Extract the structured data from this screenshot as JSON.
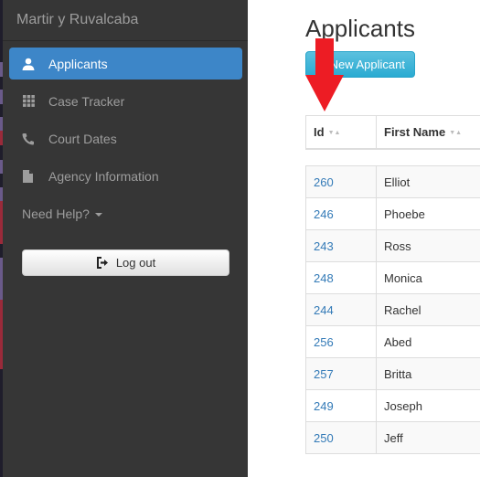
{
  "sidebar": {
    "brand": "Martir y Ruvalcaba",
    "items": [
      {
        "label": "Applicants",
        "icon": "user-icon",
        "active": true
      },
      {
        "label": "Case Tracker",
        "icon": "grid-icon",
        "active": false
      },
      {
        "label": "Court Dates",
        "icon": "phone-icon",
        "active": false
      },
      {
        "label": "Agency Information",
        "icon": "file-icon",
        "active": false
      }
    ],
    "help_label": "Need Help?",
    "logout_label": "Log out"
  },
  "main": {
    "title": "Applicants",
    "new_button_label": "New Applicant",
    "table": {
      "columns": [
        "Id",
        "First Name"
      ],
      "rows": [
        {
          "id": "260",
          "first_name": "Elliot"
        },
        {
          "id": "246",
          "first_name": "Phoebe"
        },
        {
          "id": "243",
          "first_name": "Ross"
        },
        {
          "id": "248",
          "first_name": "Monica"
        },
        {
          "id": "244",
          "first_name": "Rachel"
        },
        {
          "id": "256",
          "first_name": "Abed"
        },
        {
          "id": "257",
          "first_name": "Britta"
        },
        {
          "id": "249",
          "first_name": "Joseph"
        },
        {
          "id": "250",
          "first_name": "Jeff"
        }
      ]
    }
  },
  "annotation": {
    "type": "red-arrow",
    "color": "#ed1c24",
    "points_to": "Id column"
  },
  "colors": {
    "active_nav": "#3d86c8",
    "sidebar_bg": "#363636",
    "link": "#337ab7",
    "info_button": "#2aabd2"
  }
}
